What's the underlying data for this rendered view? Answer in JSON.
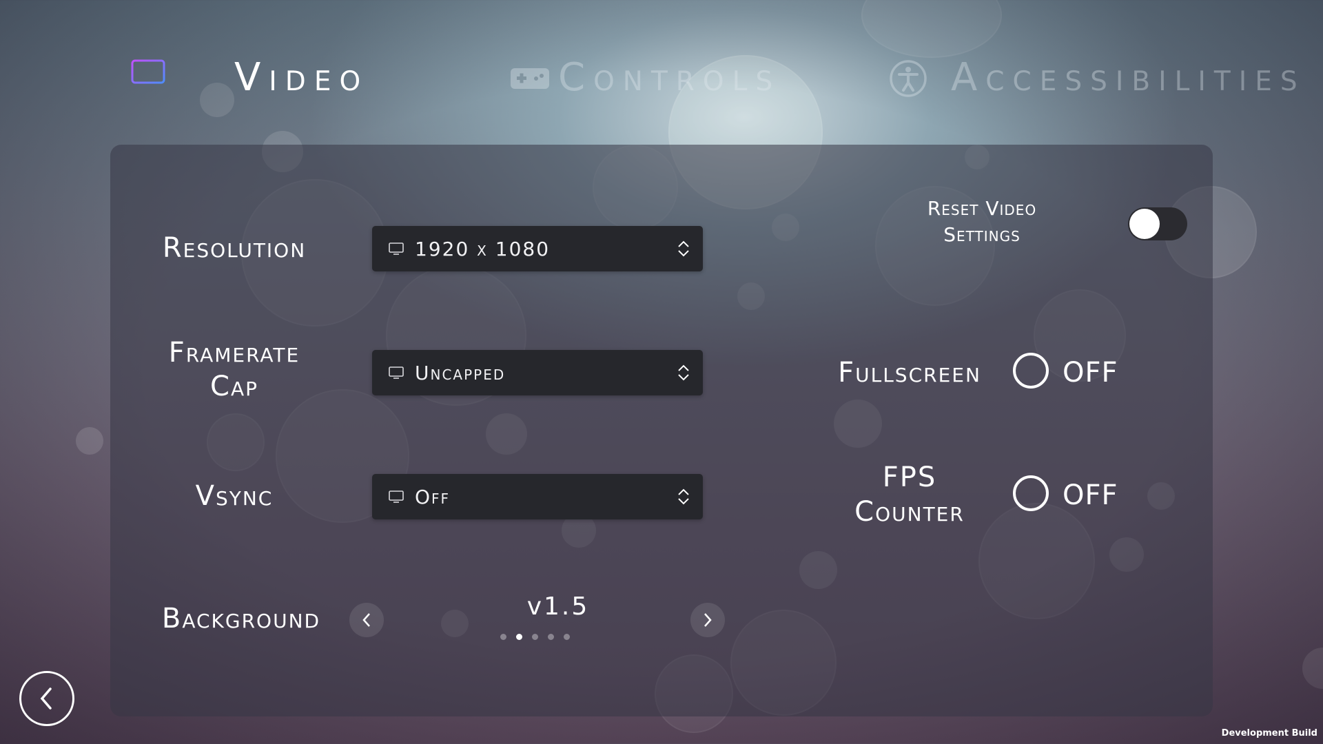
{
  "tabs": {
    "video": {
      "label": "Video",
      "icon": "monitor-icon"
    },
    "controls": {
      "label": "Controls",
      "icon": "gamepad-icon"
    },
    "accessibilities": {
      "label": "Accessibilities",
      "icon": "accessibility-icon"
    }
  },
  "settings": {
    "resolution": {
      "label": "Resolution",
      "value": "1920 x 1080"
    },
    "framerate": {
      "label_line1": "Framerate",
      "label_line2": "Cap",
      "value": "Uncapped"
    },
    "vsync": {
      "label": "Vsync",
      "value": "Off"
    },
    "background": {
      "label": "Background",
      "value": "v1.5",
      "pages": 5,
      "current_page": 2
    }
  },
  "reset": {
    "label_line1": "Reset Video",
    "label_line2": "Settings",
    "enabled": false
  },
  "fullscreen": {
    "label": "Fullscreen",
    "value": "OFF"
  },
  "fps_counter": {
    "label_line1": "FPS",
    "label_line2": "Counter",
    "value": "OFF"
  },
  "footer": {
    "build_label": "Development Build"
  },
  "colors": {
    "accent_monitor": "#b060ff",
    "dropdown_bg": "#26272c"
  }
}
